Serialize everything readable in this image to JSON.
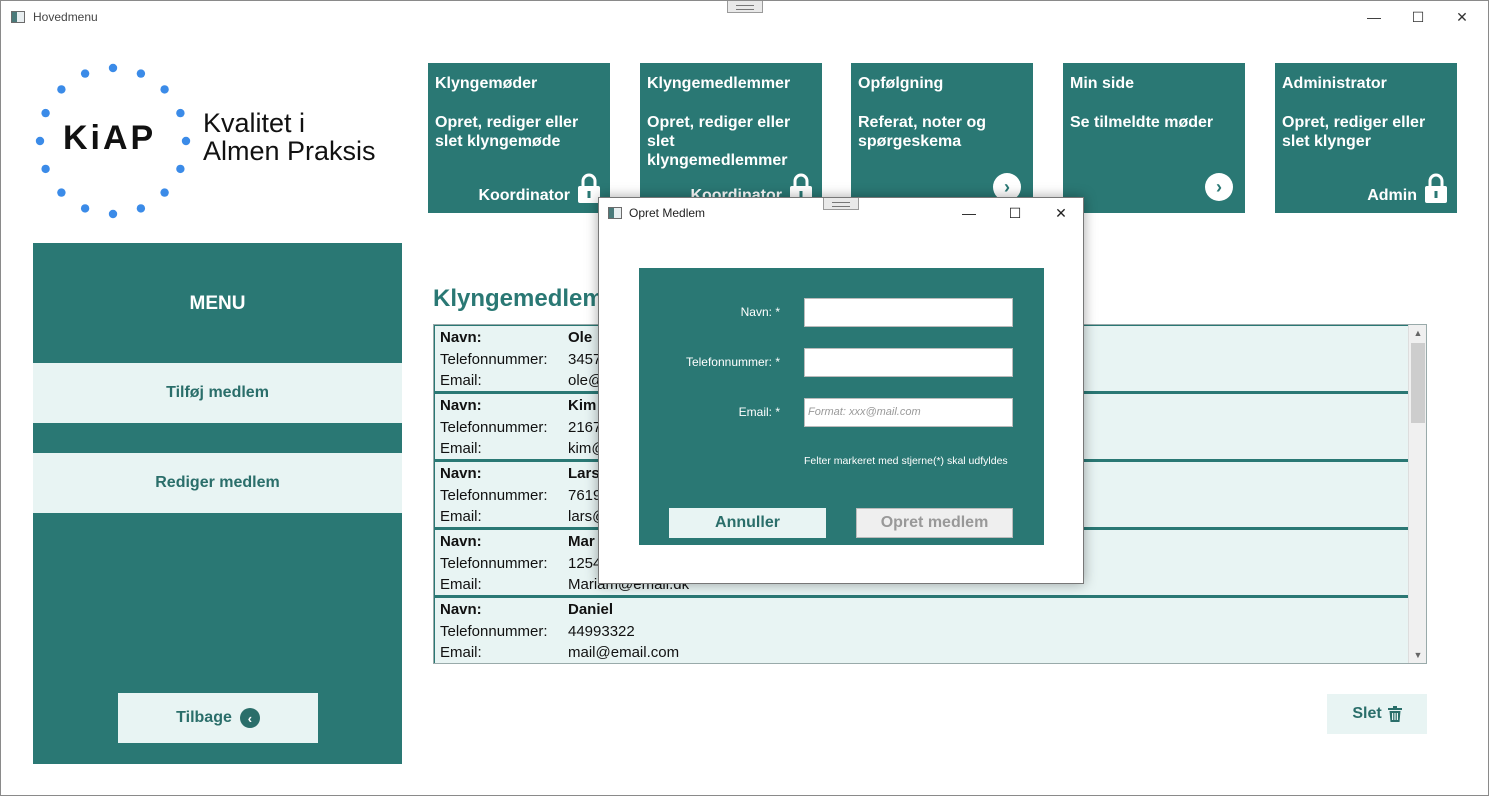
{
  "window": {
    "title": "Hovedmenu",
    "controls": {
      "minimize": "—",
      "maximize": "☐",
      "close": "✕"
    }
  },
  "logo": {
    "mark": "KiAP",
    "tagline_line1": "Kvalitet i",
    "tagline_line2": "Almen Praksis",
    "dot_color": "#3b8be8"
  },
  "tiles": [
    {
      "title": "Klyngemøder",
      "desc": "Opret, rediger eller slet klyngemøde",
      "role": "Koordinator",
      "icon": "lock-icon"
    },
    {
      "title": "Klyngemedlemmer",
      "desc": "Opret, rediger eller slet klyngemedlemmer",
      "role": "Koordinator",
      "icon": "lock-icon"
    },
    {
      "title": "Opfølgning",
      "desc": "Referat, noter og spørgeskema",
      "role": "",
      "icon": "arrow-right-icon"
    },
    {
      "title": "Min side",
      "desc": "Se tilmeldte møder",
      "role": "",
      "icon": "arrow-right-icon"
    },
    {
      "title": "Administrator",
      "desc": "Opret, rediger eller slet klynger",
      "role": "Admin",
      "icon": "lock-icon"
    }
  ],
  "sidebar": {
    "title": "MENU",
    "add_label": "Tilføj medlem",
    "edit_label": "Rediger medlem",
    "back_label": "Tilbage"
  },
  "main": {
    "section_title": "Klyngemedlemmer",
    "labels": {
      "name": "Navn:",
      "phone": "Telefonnummer:",
      "email": "Email:"
    },
    "members": [
      {
        "name": "Ole",
        "phone": "3457",
        "email": "ole@"
      },
      {
        "name": "Kim",
        "phone": "2167",
        "email": "kim@"
      },
      {
        "name": "Lars",
        "phone": "7619",
        "email": "lars@"
      },
      {
        "name": "Mar",
        "phone": "1254",
        "email": "Mariam@email.dk"
      },
      {
        "name": "Daniel",
        "phone": "44993322",
        "email": "mail@email.com"
      }
    ],
    "delete_label": "Slet"
  },
  "dialog": {
    "title": "Opret Medlem",
    "name_label": "Navn: *",
    "phone_label": "Telefonnummer: *",
    "email_label": "Email: *",
    "name_value": "",
    "phone_value": "",
    "email_placeholder": "Format: xxx@mail.com",
    "note": "Felter markeret med stjerne(*) skal udfyldes",
    "cancel_label": "Annuller",
    "create_label": "Opret medlem"
  },
  "colors": {
    "teal": "#2a7874",
    "light": "#e8f4f3",
    "accent_text": "#2a6e6a"
  }
}
